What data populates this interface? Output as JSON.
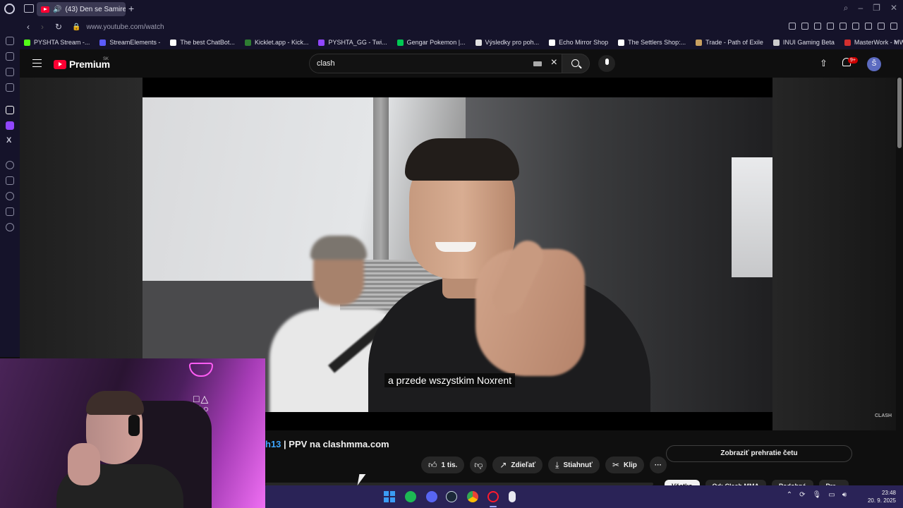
{
  "browser": {
    "tab_title": "(43) Den se Samirem a",
    "new_tab_label": "+",
    "url": "www.youtube.com/watch",
    "bookmarks": [
      {
        "label": "PYSHTA Stream -...",
        "color": "#53fc18"
      },
      {
        "label": "StreamElements -",
        "color": "#5b5bff"
      },
      {
        "label": "The best ChatBot...",
        "color": "#ffffff"
      },
      {
        "label": "Kicklet.app - Kick...",
        "color": "#2e7d32"
      },
      {
        "label": "PYSHTA_GG - Twi...",
        "color": "#9146ff"
      },
      {
        "label": "Gengar Pokemon |...",
        "color": "#00c853"
      },
      {
        "label": "Výsledky pro poh...",
        "color": "#e0e0e0"
      },
      {
        "label": "Echo Mirror Shop",
        "color": "#ffffff"
      },
      {
        "label": "The Settlers Shop:...",
        "color": "#ffffff"
      },
      {
        "label": "Trade - Path of Exile",
        "color": "#c8a060"
      },
      {
        "label": "INUI Gaming Beta",
        "color": "#cccccc"
      },
      {
        "label": "MasterWork - MW...",
        "color": "#d32f2f"
      }
    ]
  },
  "youtube": {
    "logo_text": "Premium",
    "region": "SK",
    "search_value": "clash",
    "notification_count": "9+",
    "avatar_letter": "Š",
    "subtitle": "a przede wszystkim Noxrent",
    "watermark": "CLASH",
    "title_prefix": "h13",
    "title_rest": " | PPV na clashmma.com",
    "actions": {
      "like_count": "1 tis.",
      "share": "Zdieľať",
      "download": "Stiahnuť",
      "clip": "Klip",
      "more": "···"
    },
    "chat_button": "Zobraziť prehratie četu",
    "chips": [
      "Všetko",
      "Od: Clash MMA",
      "Podobné",
      "Pre..."
    ]
  },
  "taskbar": {
    "time": "23:48",
    "date": "20. 9. 2025"
  }
}
